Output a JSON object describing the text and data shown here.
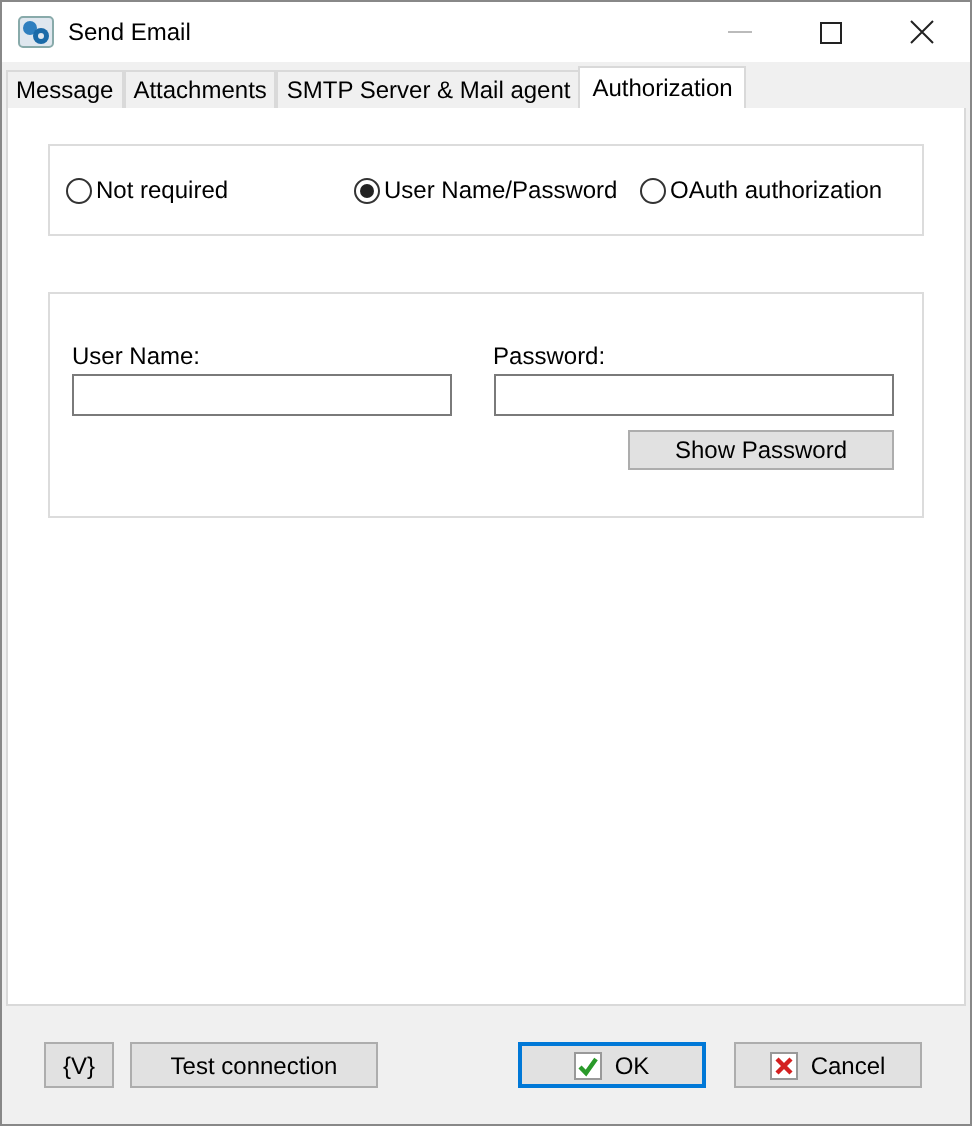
{
  "window": {
    "title": "Send Email"
  },
  "tabs": [
    {
      "label": "Message",
      "selected": false
    },
    {
      "label": "Attachments",
      "selected": false
    },
    {
      "label": "SMTP Server & Mail agent",
      "selected": false
    },
    {
      "label": "Authorization",
      "selected": true
    }
  ],
  "auth_options": [
    {
      "label": "Not required",
      "selected": false
    },
    {
      "label": "User Name/Password",
      "selected": true
    },
    {
      "label": "OAuth authorization",
      "selected": false
    }
  ],
  "credentials": {
    "user_name_label": "User Name:",
    "password_label": "Password:",
    "show_password_button": "Show Password"
  },
  "footer": {
    "variables_button": "{V}",
    "test_button": "Test connection",
    "ok_button": "OK",
    "cancel_button": "Cancel"
  }
}
